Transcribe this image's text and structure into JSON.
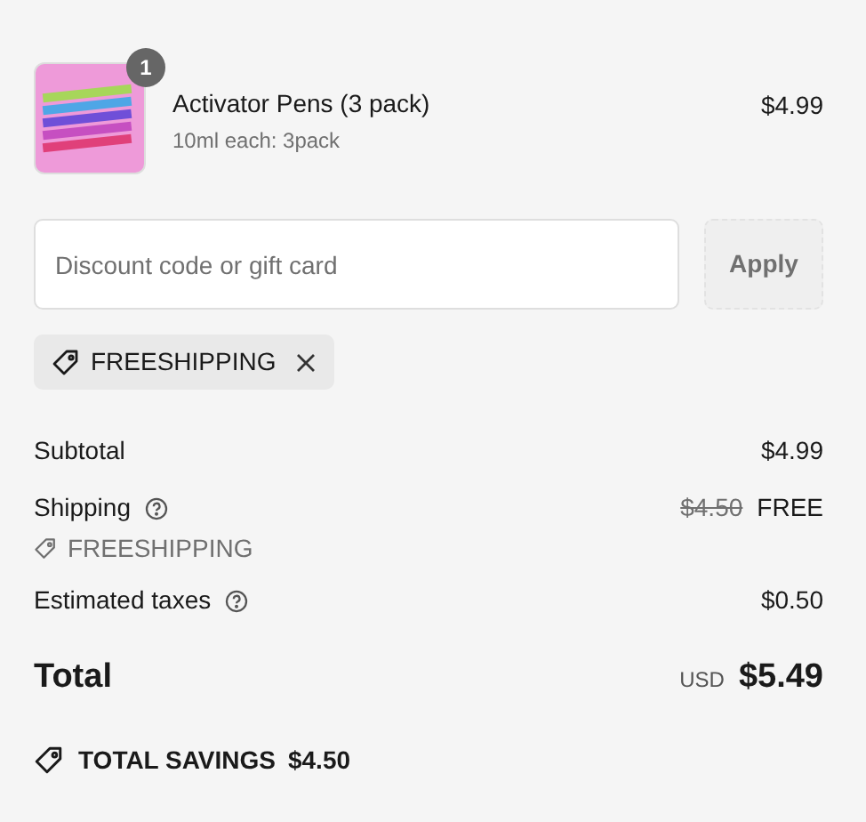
{
  "line_items": [
    {
      "quantity": "1",
      "title": "Activator Pens (3 pack)",
      "variant": "10ml each: 3pack",
      "price": "$4.99"
    }
  ],
  "discount": {
    "placeholder": "Discount code or gift card",
    "button": {
      "label": "Apply",
      "disabled": true
    }
  },
  "applied_codes": [
    {
      "code": "FREESHIPPING",
      "removable": true
    }
  ],
  "summary": [
    {
      "kind": "line",
      "label": "Subtotal",
      "help": false,
      "value": "$4.99"
    },
    {
      "kind": "line",
      "label": "Shipping",
      "help": true,
      "original_value": "$4.50",
      "value": "FREE"
    },
    {
      "kind": "code",
      "label": "FREESHIPPING"
    },
    {
      "kind": "line",
      "label": "Estimated taxes",
      "help": true,
      "value": "$0.50"
    }
  ],
  "total": {
    "label": "Total",
    "currency": "USD",
    "value": "$5.49"
  },
  "savings": {
    "label": "TOTAL SAVINGS",
    "value": "$4.50"
  }
}
